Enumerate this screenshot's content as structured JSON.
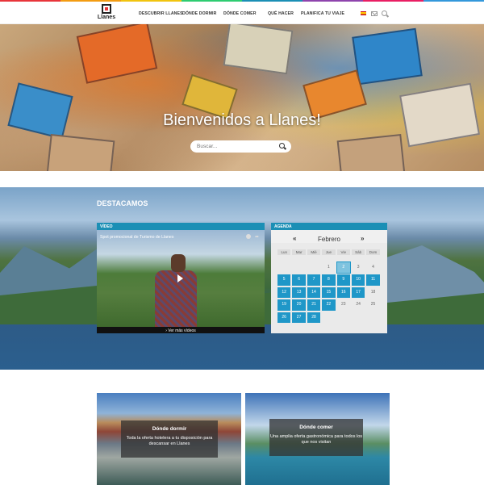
{
  "brand": {
    "name": "Llanes",
    "stripe_colors": [
      "#e8353b",
      "#f39c12",
      "#f1c40f",
      "#2ecc71",
      "#1b8fb5",
      "#8e44ad",
      "#e91e63",
      "#3498db"
    ]
  },
  "nav": {
    "items": [
      "Descubrir Llanes",
      "Dónde dormir",
      "Dónde comer",
      "Qué hacer",
      "Planifica tu viaje"
    ],
    "language_icon": "spanish-flag-icon",
    "mail_icon": "mail-icon",
    "search_icon": "search-icon"
  },
  "hero": {
    "title": "Bienvenidos a Llanes!",
    "search_placeholder": "Buscar..."
  },
  "featured": {
    "title": "Destacamos",
    "video": {
      "tab": "Vídeo",
      "caption": "Spot promocional de Turismo de Llanes",
      "more_link": "Ver más vídeos"
    },
    "agenda": {
      "tab": "Agenda",
      "prev": "«",
      "next": "»",
      "month": "Febrero",
      "weekdays": [
        "Lun",
        "Mar",
        "Mié",
        "Jue",
        "Vie",
        "Sáb",
        "Dom"
      ],
      "weeks": [
        [
          "",
          "",
          "",
          "1",
          "2",
          "3",
          "4"
        ],
        [
          "5",
          "6",
          "7",
          "8",
          "9",
          "10",
          "11"
        ],
        [
          "12",
          "13",
          "14",
          "15",
          "16",
          "17",
          "18"
        ],
        [
          "19",
          "20",
          "21",
          "22",
          "23",
          "24",
          "25"
        ],
        [
          "26",
          "27",
          "28",
          "",
          "",
          "",
          ""
        ]
      ],
      "event_days": [
        "2",
        "5",
        "6",
        "7",
        "8",
        "9",
        "10",
        "11",
        "12",
        "13",
        "14",
        "15",
        "16",
        "17",
        "19",
        "20",
        "21",
        "22",
        "26",
        "27",
        "28"
      ],
      "selected_day": "2"
    }
  },
  "cards": [
    {
      "title": "Dónde dormir",
      "description": "Toda la oferta hotelera a tu disposición para descansar en Llanes"
    },
    {
      "title": "Dónde comer",
      "description": "Una amplia oferta gastronómica para todos los que nos visitan"
    }
  ]
}
